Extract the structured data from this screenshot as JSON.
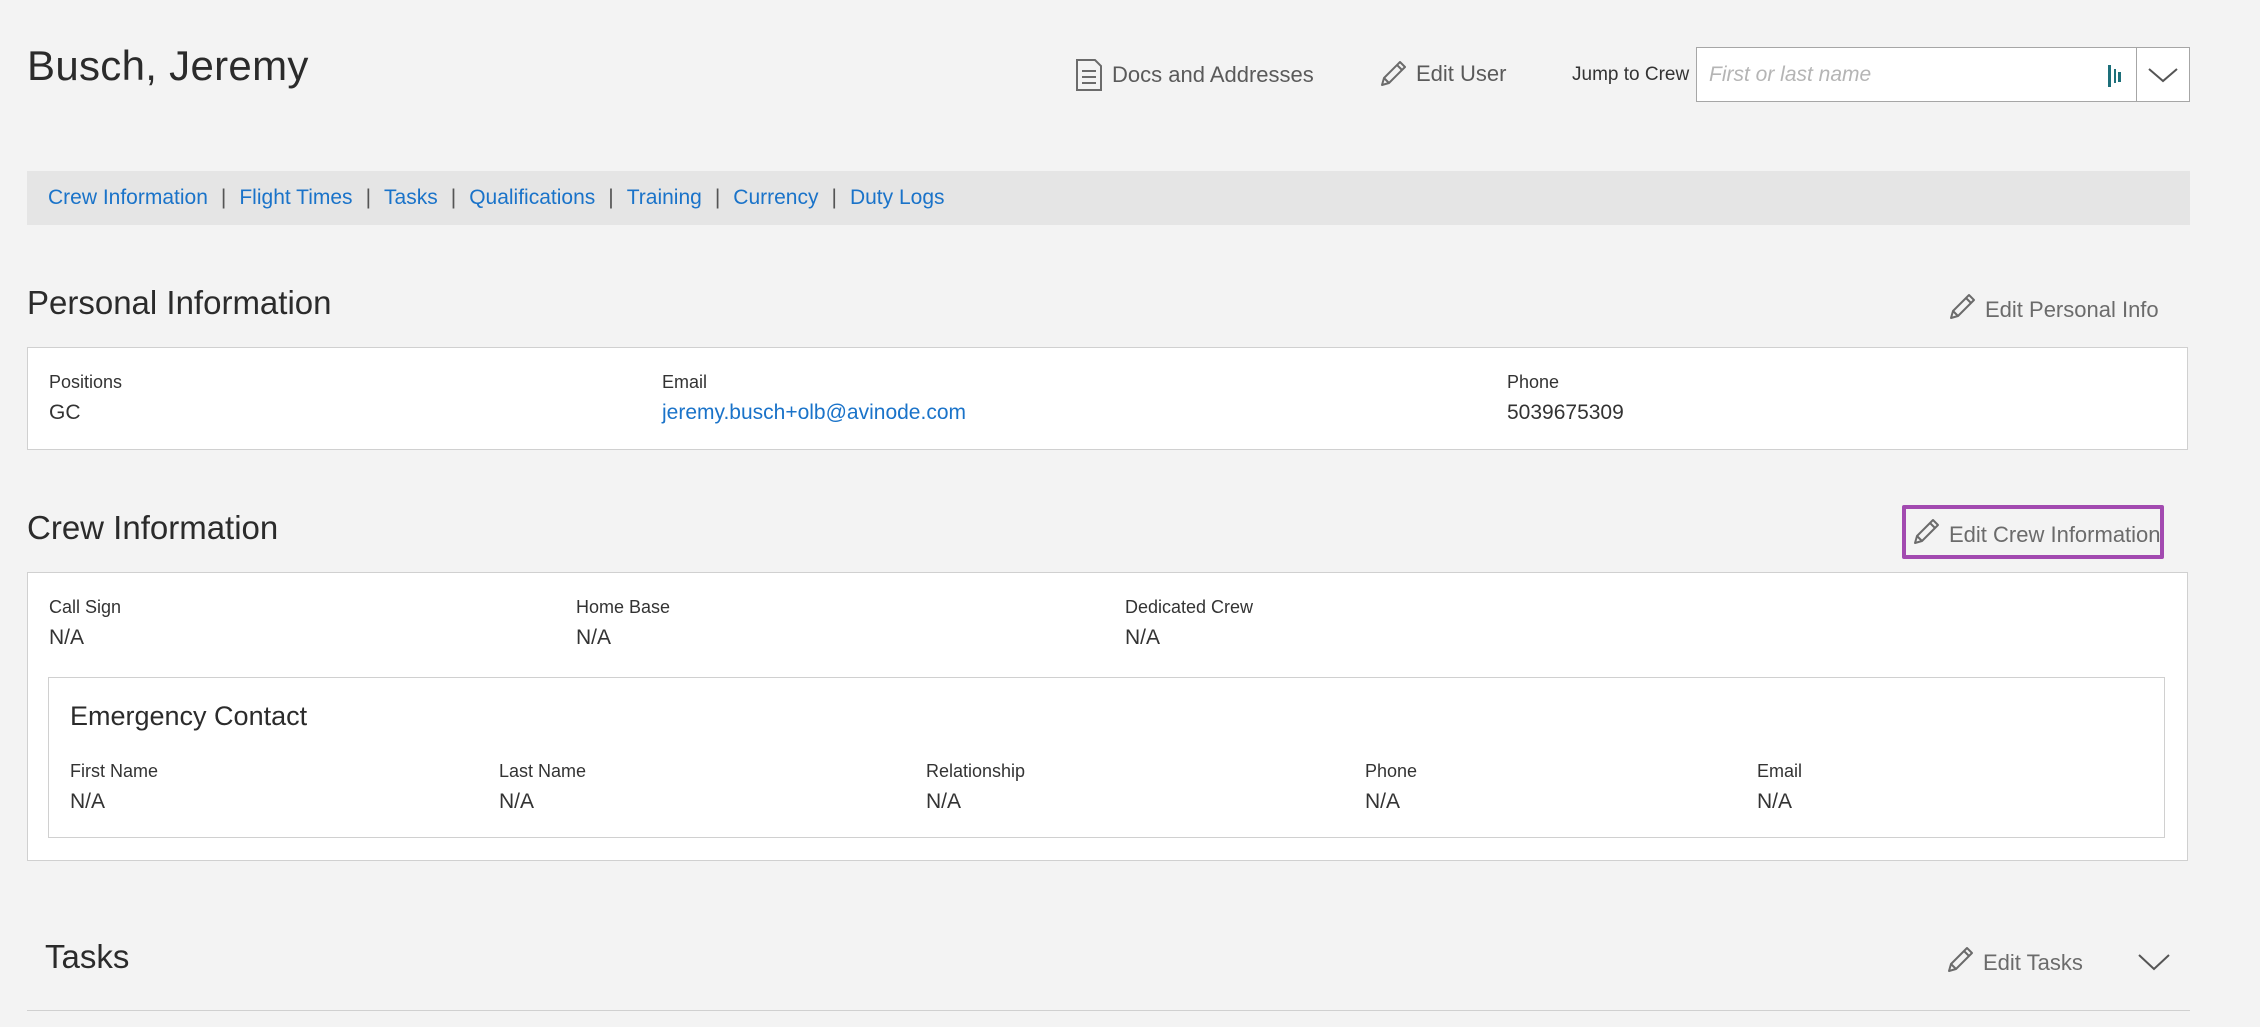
{
  "header": {
    "title": "Busch, Jeremy",
    "docs_label": "Docs and Addresses",
    "edit_user_label": "Edit User",
    "jump_label": "Jump to Crew",
    "jump_placeholder": "First or last name"
  },
  "nav": {
    "items": [
      "Crew Information",
      "Flight Times",
      "Tasks",
      "Qualifications",
      "Training",
      "Currency",
      "Duty Logs"
    ]
  },
  "personal": {
    "title": "Personal Information",
    "edit_label": "Edit Personal Info",
    "positions_label": "Positions",
    "positions_value": "GC",
    "email_label": "Email",
    "email_value": "jeremy.busch+olb@avinode.com",
    "phone_label": "Phone",
    "phone_value": "5039675309"
  },
  "crew": {
    "title": "Crew Information",
    "edit_label": "Edit Crew Information",
    "call_sign_label": "Call Sign",
    "call_sign_value": "N/A",
    "home_base_label": "Home Base",
    "home_base_value": "N/A",
    "dedicated_label": "Dedicated Crew",
    "dedicated_value": "N/A"
  },
  "emergency": {
    "title": "Emergency Contact",
    "first_name_label": "First Name",
    "first_name_value": "N/A",
    "last_name_label": "Last Name",
    "last_name_value": "N/A",
    "relationship_label": "Relationship",
    "relationship_value": "N/A",
    "phone_label": "Phone",
    "phone_value": "N/A",
    "email_label": "Email",
    "email_value": "N/A"
  },
  "tasks": {
    "title": "Tasks",
    "edit_label": "Edit Tasks"
  },
  "icons": {
    "docs": "document-icon",
    "edit": "pencil-icon",
    "scan": "barcode-icon",
    "expand": "chevron-down-icon"
  },
  "colors": {
    "link": "#1a73c9",
    "highlight": "#a24ab0",
    "background": "#f3f3f3",
    "nav_background": "#e5e5e5"
  }
}
